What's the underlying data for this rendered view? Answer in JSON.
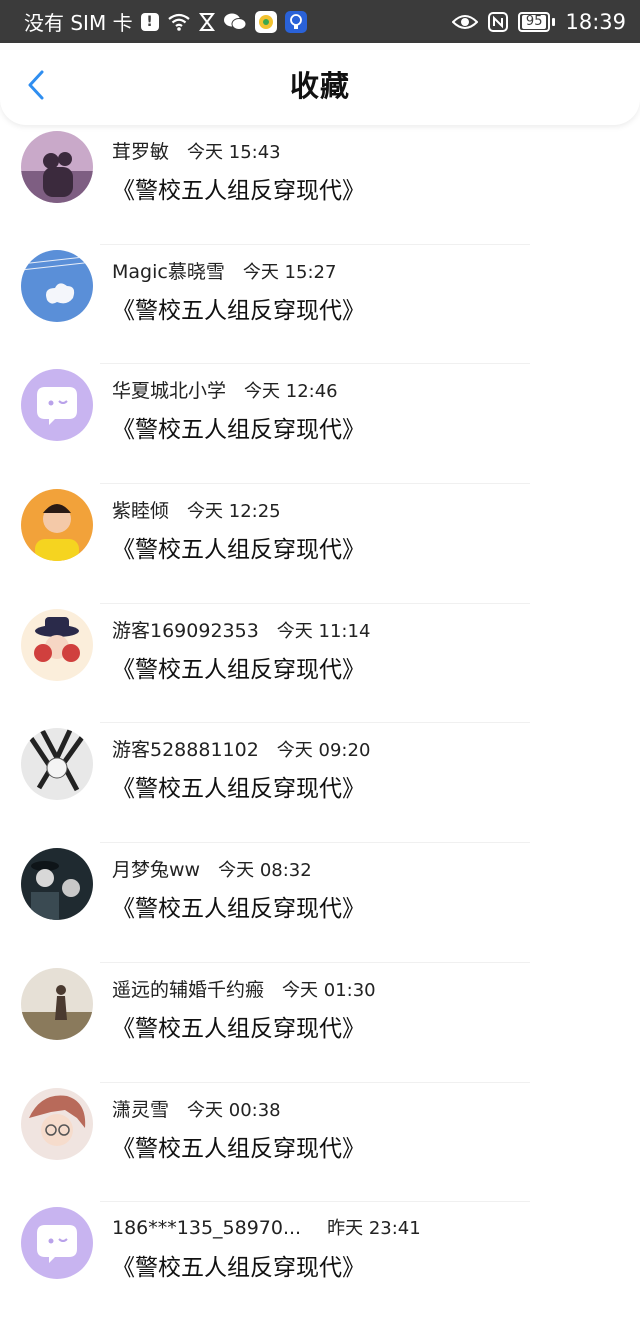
{
  "status_bar": {
    "carrier": "没有 SIM 卡",
    "time": "18:39",
    "battery": "95"
  },
  "header": {
    "title": "收藏"
  },
  "items": [
    {
      "name": "茸罗敏",
      "time": "今天 15:43",
      "book": "《警校五人组反穿现代》"
    },
    {
      "name": "Magic慕晓雪",
      "time": "今天 15:27",
      "book": "《警校五人组反穿现代》"
    },
    {
      "name": "华夏城北小学",
      "time": "今天 12:46",
      "book": "《警校五人组反穿现代》"
    },
    {
      "name": "紫睦倾",
      "time": "今天 12:25",
      "book": "《警校五人组反穿现代》"
    },
    {
      "name": "游客169092353",
      "time": "今天 11:14",
      "book": "《警校五人组反穿现代》"
    },
    {
      "name": "游客528881102",
      "time": "今天 09:20",
      "book": "《警校五人组反穿现代》"
    },
    {
      "name": "月梦兔ww",
      "time": "今天 08:32",
      "book": "《警校五人组反穿现代》"
    },
    {
      "name": "遥远的辅婚千约瘢",
      "time": "今天 01:30",
      "book": "《警校五人组反穿现代》"
    },
    {
      "name": "潇灵雪",
      "time": "今天 00:38",
      "book": "《警校五人组反穿现代》"
    },
    {
      "name": "186***135_58970...",
      "time": "昨天 23:41",
      "book": "《警校五人组反穿现代》"
    }
  ],
  "colors": {
    "accent": "#2f8ef0",
    "default_avatar_bg": "#c8b4f0"
  }
}
